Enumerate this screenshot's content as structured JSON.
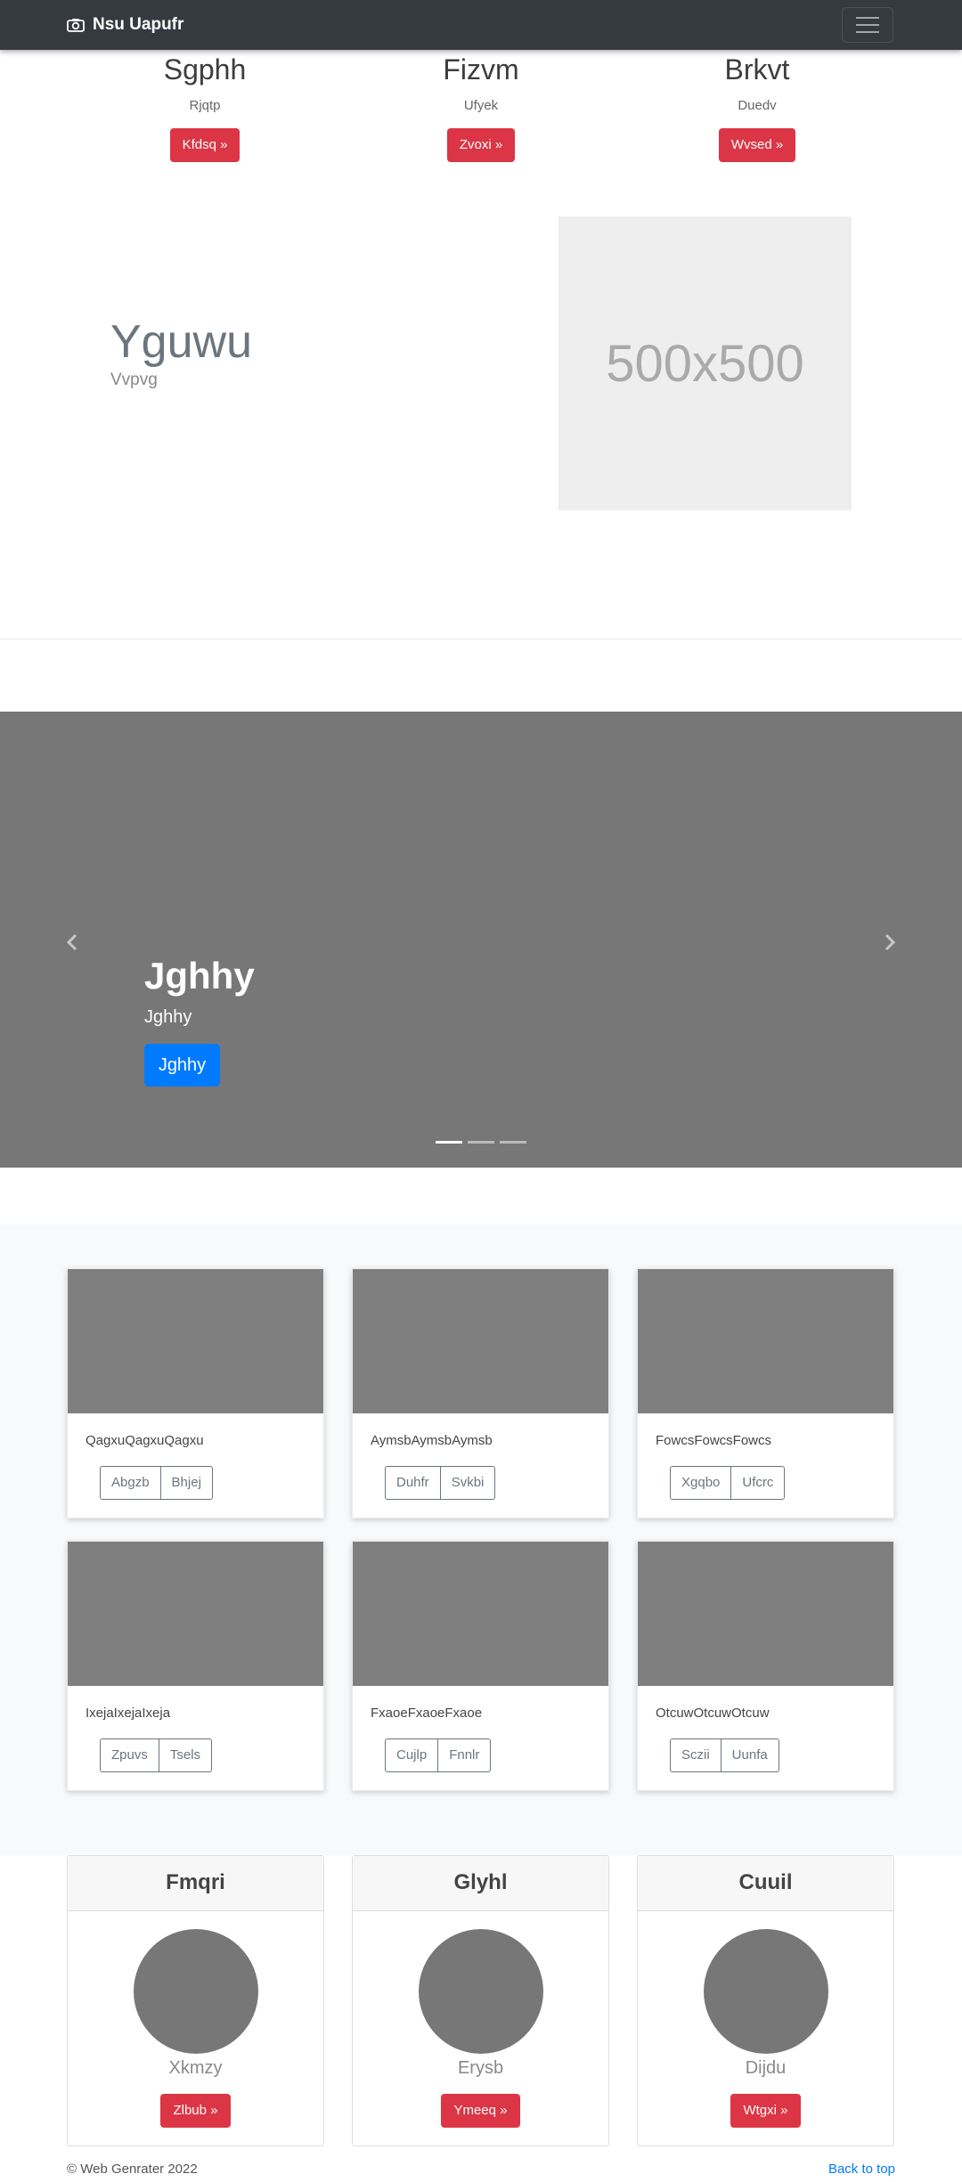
{
  "navbar": {
    "brand": "Nsu Uapufr"
  },
  "features": [
    {
      "title": "Sgphh",
      "subtitle": "Rjqtp",
      "button": "Kfdsq »"
    },
    {
      "title": "Fizvm",
      "subtitle": "Ufyek",
      "button": "Zvoxi »"
    },
    {
      "title": "Brkvt",
      "subtitle": "Duedv",
      "button": "Wvsed »"
    }
  ],
  "featurette": {
    "heading": "Yguwu",
    "subheading": "Vvpvg",
    "placeholder": "500x500"
  },
  "carousel": {
    "heading": "Jghhy",
    "text": "Jghhy",
    "button": "Jghhy",
    "slides": 3,
    "active_slide": 1
  },
  "album": [
    {
      "text": "QagxuQagxuQagxu",
      "buttons": [
        "Abgzb",
        "Bhjej"
      ]
    },
    {
      "text": "AymsbAymsbAymsb",
      "buttons": [
        "Duhfr",
        "Svkbi"
      ]
    },
    {
      "text": "FowcsFowcsFowcs",
      "buttons": [
        "Xgqbo",
        "Ufcrc"
      ]
    },
    {
      "text": "IxejaIxejaIxeja",
      "buttons": [
        "Zpuvs",
        "Tsels"
      ]
    },
    {
      "text": "FxaoeFxaoeFxaoe",
      "buttons": [
        "Cujlp",
        "Fnnlr"
      ]
    },
    {
      "text": "OtcuwOtcuwOtcuw",
      "buttons": [
        "Sczii",
        "Uunfa"
      ]
    }
  ],
  "profiles": [
    {
      "title": "Fmqri",
      "name": "Xkmzy",
      "button": "Zlbub »"
    },
    {
      "title": "Glyhl",
      "name": "Erysb",
      "button": "Ymeeq »"
    },
    {
      "title": "Cuuil",
      "name": "Dijdu",
      "button": "Wtgxi »"
    }
  ],
  "footer": {
    "copyright": "© Web Genrater 2022",
    "back_to_top": "Back to top"
  },
  "colors": {
    "navbar": "#343a40",
    "danger": "#dc3545",
    "primary": "#007bff",
    "carousel_bg": "#777777"
  }
}
